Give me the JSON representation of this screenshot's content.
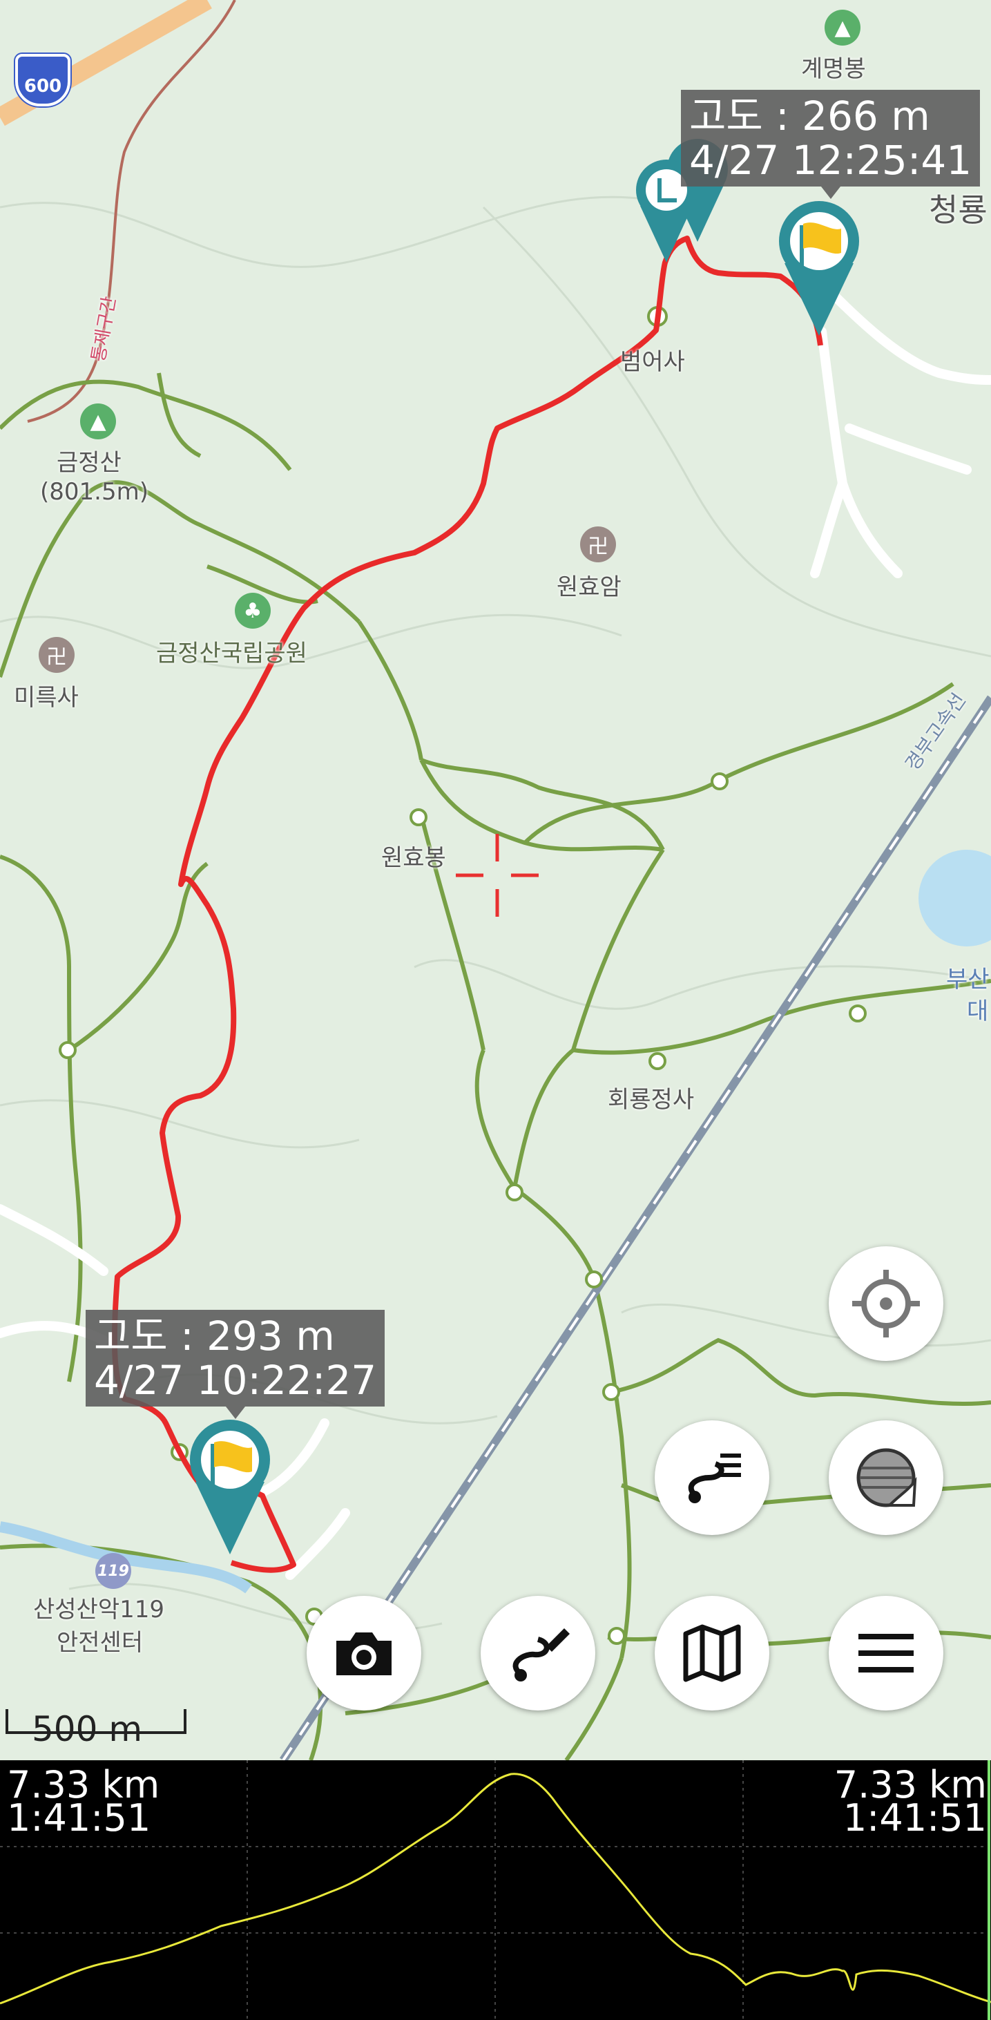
{
  "map": {
    "highway_shield": "600",
    "labels": {
      "gyemyeongbong": "계명봉",
      "cheongryong": "청룡",
      "beomeosa": "범어사",
      "geumjeongsan": "금정산",
      "geumjeongsan_elev": "(801.5m)",
      "wonhyoam": "원효암",
      "park": "금정산국립공원",
      "mireuksa": "미륵사",
      "wonhyobong": "원효봉",
      "hoeryongjeongsa": "회룡정사",
      "busan": "부산",
      "busan_2": "대",
      "expressway": "경부고속선",
      "control_section": "통제구간",
      "rescue": "산성산악119",
      "rescue_2": "안전센터"
    },
    "scale": "500 m",
    "accent_color": "#e82a2a",
    "marker_color": "#2e8f99"
  },
  "tooltips": {
    "end": {
      "altitude": "고도 : 266 m",
      "time": "4/27 12:25:41"
    },
    "start": {
      "altitude": "고도 : 293 m",
      "time": "4/27 10:22:27"
    }
  },
  "buttons": {
    "locate": "crosshair-icon",
    "track": "track-list-icon",
    "layers": "layers-icon",
    "camera": "camera-icon",
    "draw_route": "route-draw-icon",
    "map": "map-icon",
    "menu": "menu-icon"
  },
  "profile": {
    "left_distance": "7.33 km",
    "left_time": "1:41:51",
    "right_distance": "7.33 km",
    "right_time": "1:41:51",
    "line_color": "#e8e83a"
  }
}
